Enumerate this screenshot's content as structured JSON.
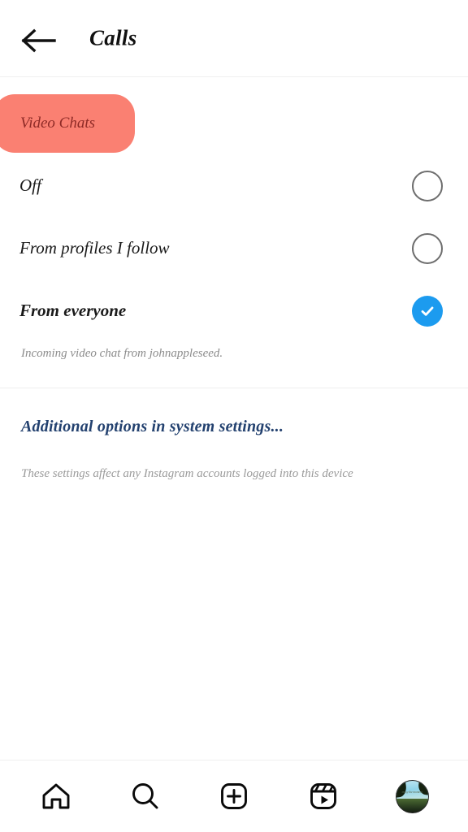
{
  "header": {
    "back_icon": "arrow-left-icon",
    "title": "Calls"
  },
  "section": {
    "badge_label": "Video Chats",
    "badge_color": "#FA8072",
    "badge_text_color": "#8E2A26"
  },
  "options": [
    {
      "label": "Off",
      "selected": false
    },
    {
      "label": "From profiles I follow",
      "selected": false
    },
    {
      "label": "From everyone",
      "selected": true
    }
  ],
  "helper_text": "Incoming video chat from johnappleseed.",
  "link_section": {
    "link_label": "Additional options in system settings...",
    "link_color": "#23416F",
    "footer_note": "These settings affect any Instagram accounts logged into this device"
  },
  "selection": {
    "accent_color": "#1C9BEF",
    "check_icon": "check-icon",
    "radio_icon": "radio-circle-icon"
  },
  "bottom_nav": [
    {
      "name": "home",
      "icon": "home-icon"
    },
    {
      "name": "search",
      "icon": "search-icon"
    },
    {
      "name": "create",
      "icon": "plus-square-icon"
    },
    {
      "name": "reels",
      "icon": "reels-icon"
    },
    {
      "name": "profile",
      "icon": "avatar-icon",
      "avatar_text": "enjoy the moment"
    }
  ]
}
